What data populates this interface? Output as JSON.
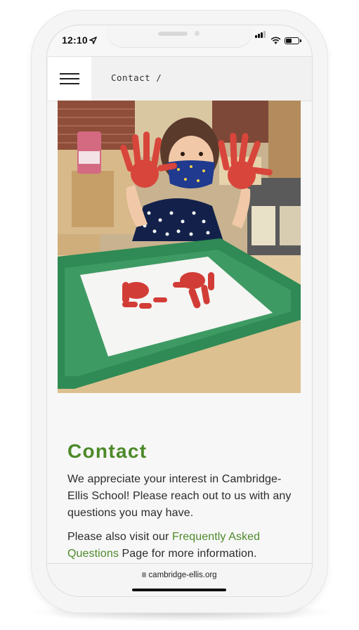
{
  "status_bar": {
    "time": "12:10"
  },
  "header": {
    "breadcrumb_label": "Contact",
    "breadcrumb_separator": "/"
  },
  "hero_image": {
    "description_icon": "photo"
  },
  "content": {
    "title": "Contact",
    "paragraph1": "We appreciate your interest in Cambridge-Ellis School! Please reach out to us with any questions you may have.",
    "paragraph2_prefix": "Please also visit our ",
    "faq_link": "Frequently Asked Questions",
    "paragraph2_suffix": " Page for more information."
  },
  "browser": {
    "url": "cambridge-ellis.org"
  },
  "colors": {
    "accent_green": "#4d8a2a",
    "text": "#2b2b2b"
  }
}
